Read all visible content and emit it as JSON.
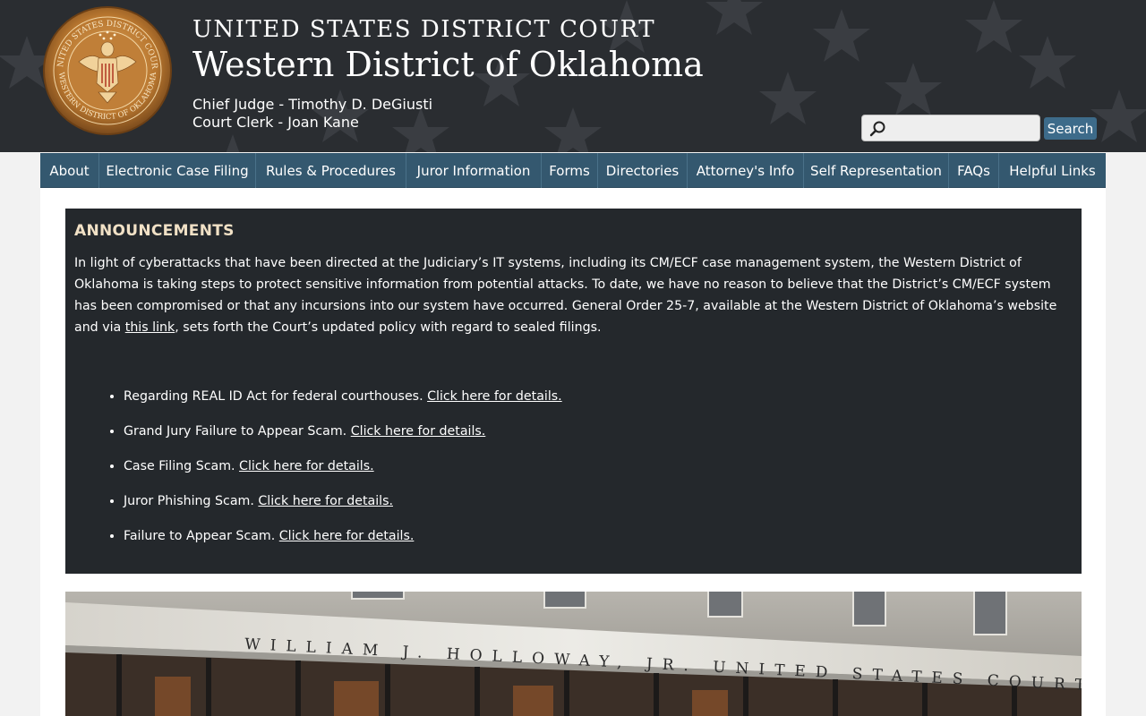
{
  "header": {
    "court_name": "UNITED STATES DISTRICT COURT",
    "district": "Western District of Oklahoma",
    "chief_judge": "Chief Judge - Timothy D. DeGiusti",
    "court_clerk": "Court Clerk - Joan Kane",
    "seal_text_top": "UNITED STATES DISTRICT COURT",
    "seal_text_bottom": "WESTERN DISTRICT OF OKLAHOMA"
  },
  "search": {
    "placeholder": "",
    "button_label": "Search"
  },
  "nav": {
    "items": [
      "About",
      "Electronic Case Filing",
      "Rules & Procedures",
      "Juror Information",
      "Forms",
      "Directories",
      "Attorney's Info",
      "Self Representation",
      "FAQs",
      "Helpful Links"
    ]
  },
  "announcements": {
    "title": "ANNOUNCEMENTS",
    "body_before_link": "In light of cyberattacks that have been directed at the Judiciary’s IT systems, including its CM/ECF case management system, the Western District of Oklahoma is taking steps to protect sensitive information from potential attacks. To date, we have no reason to believe that the District’s CM/ECF system has been compromised or that any incursions into our system have occurred. General Order 25-7, available at the Western District of Oklahoma’s website and via ",
    "body_link": "this link",
    "body_after_link": ", sets forth the Court’s updated policy with regard to sealed filings.",
    "items": [
      {
        "text": "Regarding REAL ID Act for federal courthouses. ",
        "link": "Click here for details."
      },
      {
        "text": "Grand Jury Failure to Appear Scam. ",
        "link": "Click here for details."
      },
      {
        "text": "Case Filing Scam. ",
        "link": "Click here for details."
      },
      {
        "text": "Juror Phishing Scam. ",
        "link": "Click here for details."
      },
      {
        "text": "Failure to Appear Scam. ",
        "link": "Click here for details."
      }
    ]
  },
  "photo": {
    "inscription": "WILLIAM J. HOLLOWAY, JR. UNITED STATES COURTHOUSE"
  },
  "colors": {
    "header_bg": "#2a2d31",
    "nav_bg": "#34586f",
    "announce_bg": "#24282c",
    "announce_title": "#f1e1c6",
    "search_button": "#3d6b8a"
  }
}
